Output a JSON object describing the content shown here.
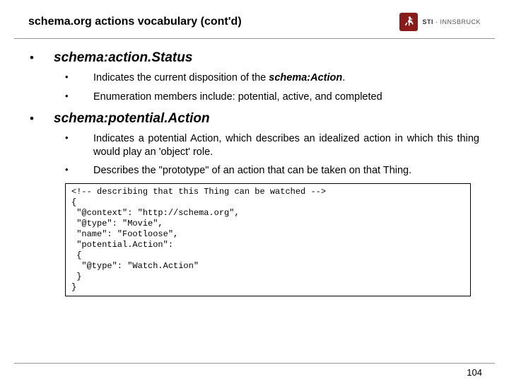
{
  "header": {
    "title": "schema.org actions vocabulary (cont'd)",
    "logo_primary": "STI",
    "logo_secondary": "INNSBRUCK"
  },
  "sections": [
    {
      "heading": "schema:action.Status",
      "bullets": [
        {
          "prefix": "Indicates the current disposition of the ",
          "emph": "schema:Action",
          "suffix": "."
        },
        {
          "text": "Enumeration members include: potential, active, and completed"
        }
      ]
    },
    {
      "heading": "schema:potential.Action",
      "bullets": [
        {
          "text": "Indicates a potential Action, which describes an idealized action in which this thing would play an 'object' role."
        },
        {
          "text": "Describes the \"prototype\" of an action that can be taken on that Thing."
        }
      ]
    }
  ],
  "code": "<!-- describing that this Thing can be watched -->\n{\n \"@context\": \"http://schema.org\",\n \"@type\": \"Movie\",\n \"name\": \"Footloose\",\n \"potential.Action\":\n {\n  \"@type\": \"Watch.Action\"\n }\n}",
  "page_number": "104"
}
